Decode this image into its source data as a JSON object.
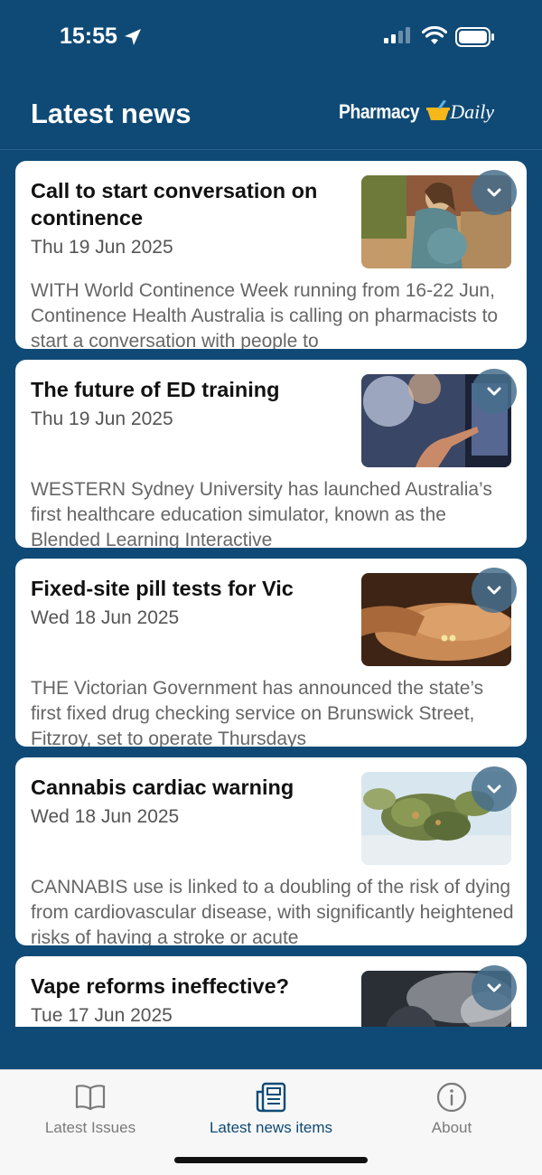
{
  "status_bar": {
    "time": "15:55"
  },
  "header": {
    "title": "Latest news",
    "logo_word1": "Pharmacy",
    "logo_word2": "Daily"
  },
  "articles": [
    {
      "title": "Call to start conversation on continence",
      "date": "Thu 19 Jun 2025",
      "excerpt": "WITH World Continence Week running from 16-22 Jun, Continence Health Australia is calling on pharmacists to start a conversation with people to",
      "thumb": "pregnant-woman-photo"
    },
    {
      "title": "The future of ED training",
      "date": "Thu 19 Jun 2025",
      "excerpt": "WESTERN Sydney University has launched Australia’s first healthcare education simulator, known as the Blended Learning Interactive",
      "thumb": "hand-touchscreen-photo"
    },
    {
      "title": "Fixed-site pill tests for Vic",
      "date": "Wed 18 Jun 2025",
      "excerpt": "THE Victorian Government has announced the state’s first fixed drug checking service on Brunswick Street, Fitzroy, set to operate Thursdays",
      "thumb": "pills-in-hand-photo"
    },
    {
      "title": "Cannabis cardiac warning",
      "date": "Wed 18 Jun 2025",
      "excerpt": "CANNABIS use is linked to a doubling of the risk of dying from cardiovascular disease, with significantly heightened risks of having a stroke or acute",
      "thumb": "cannabis-buds-photo"
    },
    {
      "title": "Vape reforms ineffective?",
      "date": "Tue 17 Jun 2025",
      "excerpt": "",
      "thumb": "vape-smoke-photo"
    }
  ],
  "tabbar": {
    "tabs": [
      {
        "label": "Latest Issues",
        "icon": "open-book-icon",
        "active": false
      },
      {
        "label": "Latest news items",
        "icon": "newspaper-icon",
        "active": true
      },
      {
        "label": "About",
        "icon": "info-icon",
        "active": false
      }
    ]
  },
  "colors": {
    "header_bg": "#0f4a76",
    "active_tab": "#0f4a76",
    "inactive_tab": "#7a7a7a",
    "logo_cup": "#f5b719"
  }
}
